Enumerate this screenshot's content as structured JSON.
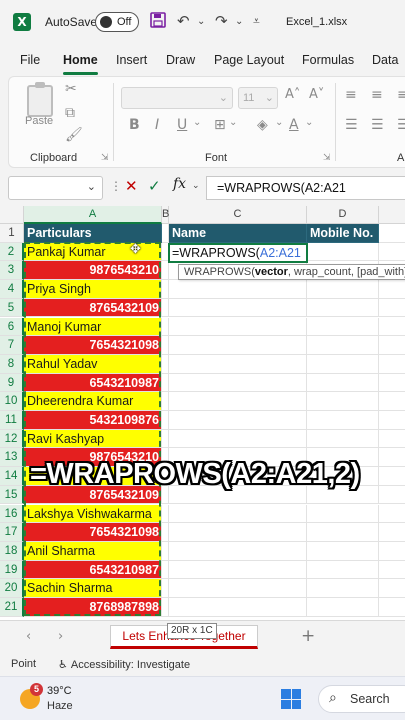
{
  "title_bar": {
    "autosave_label": "AutoSave",
    "autosave_state": "Off",
    "filename": "Excel_1.xlsx"
  },
  "menu": {
    "tabs": [
      "File",
      "Home",
      "Insert",
      "Draw",
      "Page Layout",
      "Formulas",
      "Data"
    ],
    "active": "Home"
  },
  "ribbon": {
    "paste_label": "Paste",
    "clipboard_label": "Clipboard",
    "font_label": "Font",
    "font_size": "11",
    "bold": "B",
    "italic": "I",
    "underline": "U",
    "group_a_label": "A"
  },
  "formula_bar": {
    "fx": "fx",
    "formula": "=WRAPROWS(A2:A21"
  },
  "columns": [
    "A",
    "B",
    "C",
    "D"
  ],
  "rows": [
    "1",
    "2",
    "3",
    "4",
    "5",
    "6",
    "7",
    "8",
    "9",
    "10",
    "11",
    "12",
    "13",
    "14",
    "15",
    "16",
    "17",
    "18",
    "19",
    "20",
    "21"
  ],
  "headers": {
    "a": "Particulars",
    "c": "Name",
    "d": "Mobile No."
  },
  "data": [
    "Pankaj Kumar",
    "9876543210",
    "Priya Singh",
    "8765432109",
    "Manoj Kumar",
    "7654321098",
    "Rahul Yadav",
    "6543210987",
    "Dheerendra Kumar",
    "5432109876",
    "Ravi Kashyap",
    "9876543210",
    "",
    "8765432109",
    "Lakshya Vishwakarma",
    "7654321098",
    "Anil Sharma",
    "6543210987",
    "Sachin Sharma",
    "8768987898"
  ],
  "active_cell": {
    "prefix": "=WRAPROWS(",
    "ref": "A2:A21"
  },
  "tooltip": {
    "fn": "WRAPROWS(",
    "arg1": "vector",
    "rest": ", wrap_count, [pad_with])"
  },
  "overlay_text": "=WRAPROWS(A2:A21,2)",
  "sheet": {
    "tab": "Lets Enhance Together",
    "size_tip": "20R x 1C"
  },
  "status": {
    "mode": "Point",
    "accessibility": "Accessibility: Investigate"
  },
  "taskbar": {
    "badge": "5",
    "temp": "39°C",
    "weather": "Haze",
    "search": "Search"
  },
  "colors": {
    "excel_green": "#107c41",
    "header_fill": "#215a6d",
    "name_fill": "#ffff00",
    "phone_fill": "#e41f1f"
  }
}
